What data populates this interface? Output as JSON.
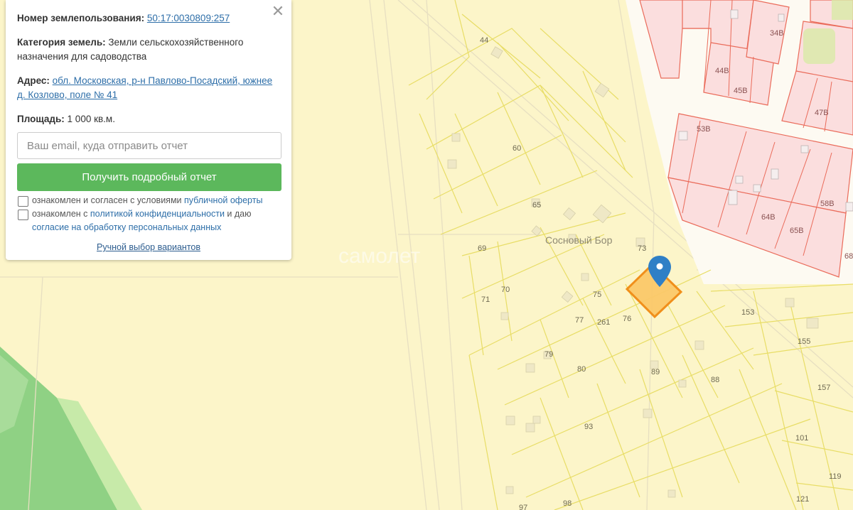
{
  "panel": {
    "close_symbol": "✕",
    "cadastral_label": "Номер землепользования:",
    "cadastral_value": "50:17:0030809:257",
    "category_label": "Категория земель:",
    "category_value": "Земли сельскохозяйственного назначения для садоводства",
    "address_label": "Адрес:",
    "address_value": "обл. Московская, р-н Павлово-Посадский, южнее д. Козлово, поле № 41",
    "area_label": "Площадь:",
    "area_value": "1 000 кв.м.",
    "email_placeholder": "Ваш email, куда отправить отчет",
    "submit_label": "Получить подробный отчет",
    "agree1_text": "ознакомлен и согласен с условиями ",
    "agree1_link": "публичной оферты",
    "agree2_text": "ознакомлен с ",
    "agree2_link": "политикой конфиденциальности",
    "agree2_text2": " и даю",
    "agree2_link2": "согласие на обработку персональных данных",
    "manual_link": "Ручной выбор вариантов"
  },
  "map": {
    "place_label": "Сосновый Бор",
    "watermark": "самолет",
    "colors": {
      "bg": "#fcf5c9",
      "parcel_line": "#e8dd66",
      "forest": "#8fd184",
      "residential": "#fbdede",
      "residential_line": "#ea6b5a",
      "selected_fill": "#fbc96a",
      "selected_stroke": "#f08a12",
      "pin": "#2f7fc6"
    },
    "plot_labels": [
      "44",
      "60",
      "65",
      "69",
      "70",
      "71",
      "73",
      "75",
      "76",
      "77",
      "261",
      "79",
      "80",
      "89",
      "88",
      "93",
      "97",
      "98",
      "101",
      "119",
      "121",
      "153",
      "155",
      "157",
      "34В",
      "44В",
      "45В",
      "47В",
      "53В",
      "58В",
      "64В",
      "65В",
      "68"
    ]
  }
}
